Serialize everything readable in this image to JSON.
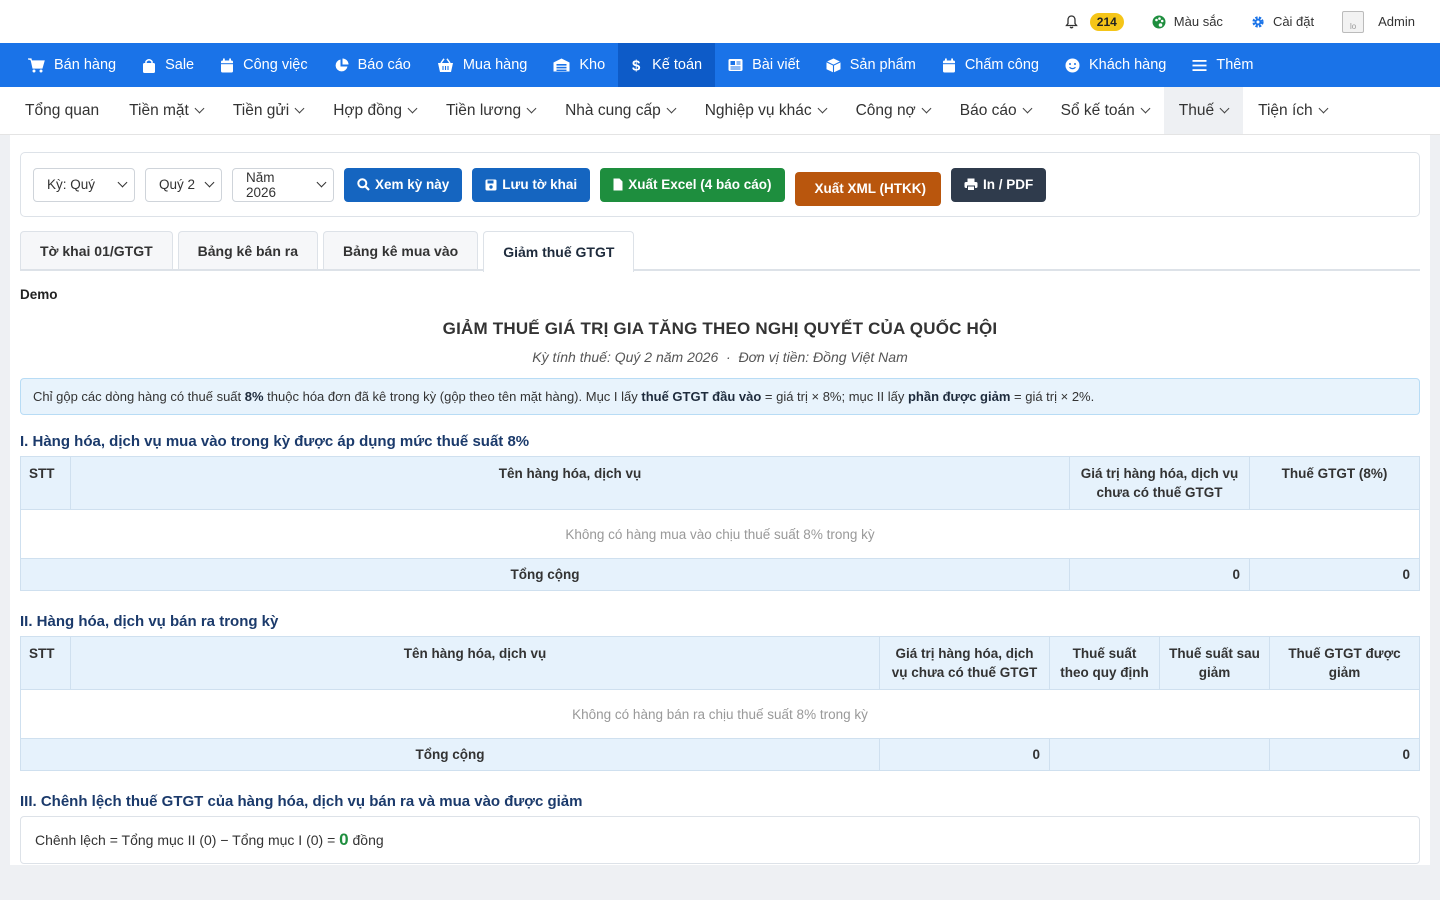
{
  "topbar": {
    "notif_count": "214",
    "color_label": "Màu sắc",
    "settings_label": "Cài đặt",
    "avatar_alt": "lo",
    "user_label": "Admin"
  },
  "mainnav": [
    "Bán hàng",
    "Sale",
    "Công việc",
    "Báo cáo",
    "Mua hàng",
    "Kho",
    "Kế toán",
    "Bài viết",
    "Sản phẩm",
    "Chấm công",
    "Khách hàng",
    "Thêm"
  ],
  "subnav": [
    "Tổng quan",
    "Tiền mặt",
    "Tiền gửi",
    "Hợp đồng",
    "Tiền lương",
    "Nhà cung cấp",
    "Nghiệp vụ khác",
    "Công nợ",
    "Báo cáo",
    "Sổ kế toán",
    "Thuế",
    "Tiện ích"
  ],
  "toolbar": {
    "period_type": "Kỳ: Quý",
    "quarter": "Quý 2",
    "year": "Năm 2026",
    "view_btn": "Xem kỳ này",
    "save_btn": "Lưu tờ khai",
    "excel_btn": "Xuất Excel (4 báo cáo)",
    "xml_btn": "Xuất XML (HTKK)",
    "print_btn": "In / PDF"
  },
  "tabs": [
    "Tờ khai 01/GTGT",
    "Bảng kê bán ra",
    "Bảng kê mua vào",
    "Giảm thuế GTGT"
  ],
  "company": "Demo",
  "doc": {
    "title": "GIẢM THUẾ GIÁ TRỊ GIA TĂNG THEO NGHỊ QUYẾT CỦA QUỐC HỘI",
    "subtitle": "Kỳ tính thuế: Quý 2 năm 2026  ·  Đơn vị tiền: Đồng Việt Nam"
  },
  "info": {
    "p1": "Chỉ gộp các dòng hàng có thuế suất ",
    "b1": "8%",
    "p2": " thuộc hóa đơn đã kê trong kỳ (gộp theo tên mặt hàng). Mục I lấy ",
    "b2": "thuế GTGT đầu vào",
    "p3": " = giá trị × 8%; mục II lấy ",
    "b3": "phần được giảm",
    "p4": " = giá trị × 2%."
  },
  "section1": {
    "title": "I. Hàng hóa, dịch vụ mua vào trong kỳ được áp dụng mức thuế suất 8%",
    "col_stt": "STT",
    "col_name": "Tên hàng hóa, dịch vụ",
    "col_value": "Giá trị hàng hóa, dịch vụ chưa có thuế GTGT",
    "col_tax": "Thuế GTGT (8%)",
    "empty": "Không có hàng mua vào chịu thuế suất 8% trong kỳ",
    "total_label": "Tổng cộng",
    "total_value": "0",
    "total_tax": "0"
  },
  "section2": {
    "title": "II. Hàng hóa, dịch vụ bán ra trong kỳ",
    "col_stt": "STT",
    "col_name": "Tên hàng hóa, dịch vụ",
    "col_value": "Giá trị hàng hóa, dịch vụ chưa có thuế GTGT",
    "col_rate": "Thuế suất theo quy định",
    "col_rate_after": "Thuế suất sau giảm",
    "col_reduced": "Thuế GTGT được giảm",
    "empty": "Không có hàng bán ra chịu thuế suất 8% trong kỳ",
    "total_label": "Tổng cộng",
    "total_value": "0",
    "total_rate": "",
    "total_reduced": "0"
  },
  "section3": {
    "title": "III. Chênh lệch thuế GTGT của hàng hóa, dịch vụ bán ra và mua vào được giảm",
    "formula": "Chênh lệch = Tổng mục II (0) − Tổng mục I (0) = ",
    "result": "0",
    "unit": " đồng"
  }
}
